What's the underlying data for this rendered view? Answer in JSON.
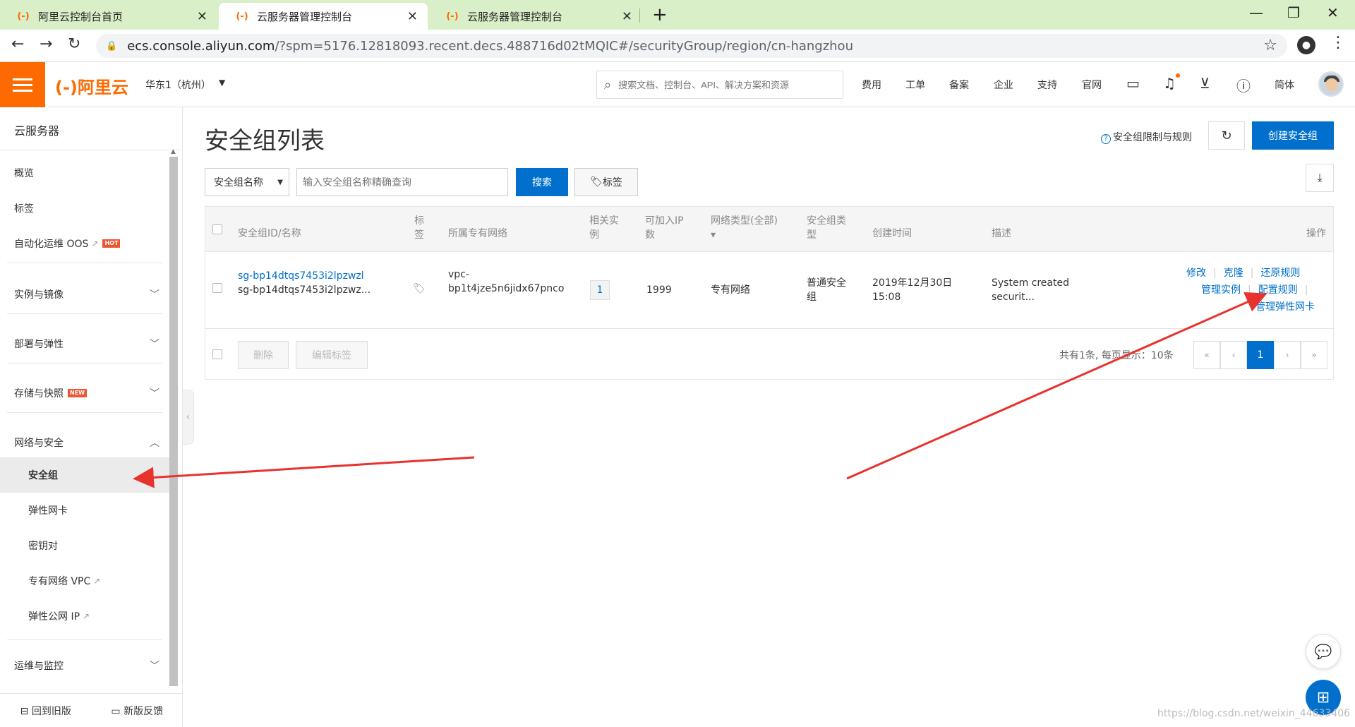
{
  "browser": {
    "tabs": [
      {
        "title": "阿里云控制台首页",
        "favicon": "(-)"
      },
      {
        "title": "云服务器管理控制台",
        "favicon": "(-)"
      },
      {
        "title": "云服务器管理控制台",
        "favicon": "(-)"
      }
    ],
    "url_host": "ecs.console.aliyun.com",
    "url_rest": "/?spm=5176.12818093.recent.decs.488716d02tMQIC#/securityGroup/region/cn-hangzhou"
  },
  "topnav": {
    "logo": "(-)阿里云",
    "region": "华东1（杭州）",
    "search_placeholder": "搜索文档、控制台、API、解决方案和资源",
    "links": [
      "费用",
      "工单",
      "备案",
      "企业",
      "支持",
      "官网"
    ],
    "lang": "简体",
    "accent_color": "#ff6a00"
  },
  "sidebar": {
    "title": "云服务器",
    "top_items": [
      "概览",
      "标签",
      "自动化运维 OOS"
    ],
    "hot_badge": "HOT",
    "new_badge": "NEW",
    "groups": [
      "实例与镜像",
      "部署与弹性",
      "存储与快照",
      "网络与安全"
    ],
    "network_items": [
      "安全组",
      "弹性网卡",
      "密钥对",
      "专有网络 VPC",
      "弹性公网 IP"
    ],
    "ops_group": "运维与监控",
    "back_old": "回到旧版",
    "feedback": "新版反馈"
  },
  "main": {
    "title": "安全组列表",
    "help_link": "安全组限制与规则",
    "create_button": "创建安全组",
    "filter_select": "安全组名称",
    "filter_placeholder": "输入安全组名称精确查询",
    "search_button": "搜索",
    "tag_button": "标签",
    "columns": {
      "id_name": "安全组ID/名称",
      "tag": [
        "标",
        "签"
      ],
      "vpc": "所属专有网络",
      "related": [
        "相关实",
        "例"
      ],
      "ip": [
        "可加入IP",
        "数"
      ],
      "net_type": "网络类型(全部)",
      "sg_type": [
        "安全组类",
        "型"
      ],
      "created": "创建时间",
      "desc": "描述",
      "actions": "操作"
    },
    "row": {
      "id": "sg-bp14dtqs7453i2lpzwzl",
      "name": "sg-bp14dtqs7453i2lpzwz...",
      "vpc_line1": "vpc-",
      "vpc_line2": "bp1t4jze5n6jidx67pnco",
      "related": "1",
      "ip_count": "1999",
      "net_type": "专有网络",
      "sg_type_1": "普通安全",
      "sg_type_2": "组",
      "created_1": "2019年12月30日",
      "created_2": "15:08",
      "desc_1": "System created",
      "desc_2": "securit...",
      "actions": {
        "modify": "修改",
        "clone": "克隆",
        "restore": "还原规则",
        "manage": "管理实例",
        "configure": "配置规则",
        "eni": "管理弹性网卡"
      }
    },
    "delete_button": "删除",
    "edit_tag_button": "编辑标签",
    "pager_info": "共有1条, 每页显示：10条",
    "pager": {
      "first": "«",
      "prev": "‹",
      "current": "1",
      "next": "›",
      "last": "»"
    }
  },
  "watermark": "https://blog.csdn.net/weixin_44633406"
}
